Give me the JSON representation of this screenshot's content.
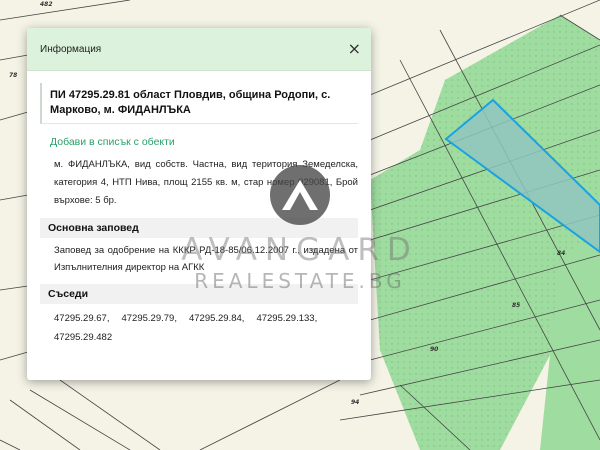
{
  "map": {
    "labels": [
      "482",
      "78",
      "84",
      "85",
      "90",
      "94"
    ],
    "colors": {
      "background": "#f4f3e6",
      "green_area": "#9fdca0",
      "selected_parcel": "#8fc6c0",
      "selected_border": "#1aa3e0",
      "lines": "#444444"
    }
  },
  "popup": {
    "title": "Информация",
    "close_icon": "×",
    "parcel_title": "ПИ 47295.29.81 област Пловдив, община Родопи, с. Марково, м. ФИДАНЛЪКА",
    "add_link": "Добави в списък с обекти",
    "details": "м. ФИДАНЛЪКА, вид собств. Частна, вид територия Земеделска, категория 4, НТП Нива, площ 2155 кв. м, стар номер 029081, Брой върхове: 5 бр.",
    "order_heading": "Основна заповед",
    "order_text": "Заповед за одобрение на КККР РД-18-85/06.12.2007 г., издадена от Изпълнителния директор на АГКК",
    "neighbors_heading": "Съседи",
    "neighbors": [
      "47295.29.67,",
      "47295.29.79,",
      "47295.29.84,",
      "47295.29.133,",
      "47295.29.482"
    ]
  },
  "watermark": {
    "brand": "AVANGARD",
    "sub": "REALESTATE.BG"
  }
}
